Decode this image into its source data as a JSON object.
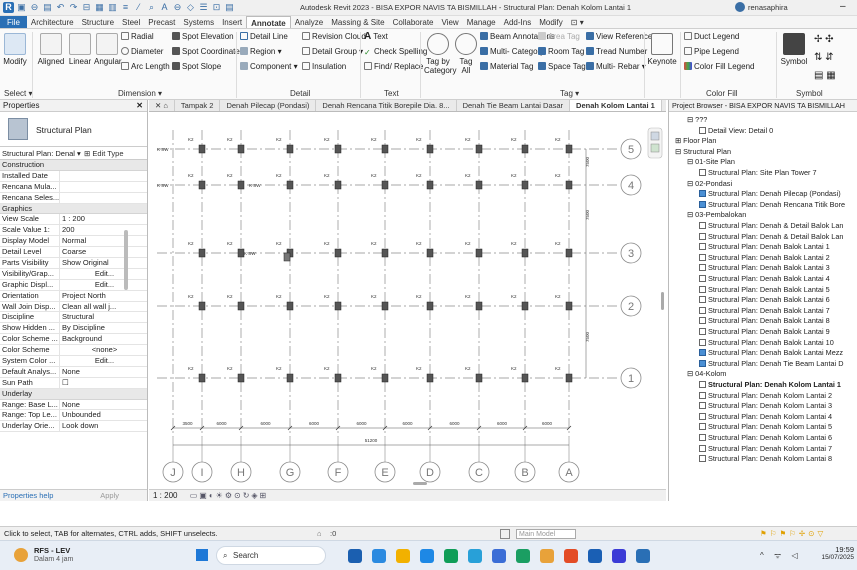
{
  "title_bar": {
    "title": "Autodesk Revit 2023 - BISA EXPOR NAVIS TA BISMILLAH - Structural Plan: Denah Kolom Lantai 1",
    "user": "renasaphira",
    "quick_access": [
      "R",
      "▣",
      "⊖",
      "▤",
      "↶",
      "↷",
      "⊟",
      "▦",
      "▥",
      "≡",
      "⁄",
      "⌕",
      "A",
      "⊖",
      "◇",
      "☰",
      "⊡",
      "▤"
    ]
  },
  "ribbon_tabs": [
    "File",
    "Architecture",
    "Structure",
    "Steel",
    "Precast",
    "Systems",
    "Insert",
    "Annotate",
    "Analyze",
    "Massing & Site",
    "Collaborate",
    "View",
    "Manage",
    "Add-Ins",
    "Modify"
  ],
  "active_tab": "Annotate",
  "ribbon": {
    "select": {
      "modify": "Modify",
      "label": "Select ▾"
    },
    "dimension": {
      "aligned": "Aligned",
      "linear": "Linear",
      "angular": "Angular",
      "radial": "Radial",
      "diameter": "Diameter",
      "arc_length": "Arc Length",
      "spot_elevation": "Spot Elevation",
      "spot_coordinate": "Spot Coordinate",
      "spot_slope": "Spot Slope",
      "label": "Dimension ▾"
    },
    "detail": {
      "detail_line": "Detail Line",
      "region": "Region ▾",
      "component": "Component ▾",
      "revision_cloud": "Revision Cloud",
      "detail_group": "Detail Group ▾",
      "insulation": "Insulation",
      "label": "Detail"
    },
    "text": {
      "text": "Text",
      "check_spelling": "Check Spelling",
      "find_replace": "Find/ Replace",
      "label": "Text"
    },
    "tag": {
      "tag_by_category": "Tag by Category",
      "tag_all": "Tag All",
      "beam_annotations": "Beam Annotations",
      "multi_category": "Multi- Category",
      "material_tag": "Material Tag",
      "area_tag": "Area Tag",
      "room_tag": "Room Tag",
      "space_tag": "Space Tag",
      "view_reference": "View Reference",
      "tread_number": "Tread Number",
      "multi_rebar": "Multi- Rebar ▾",
      "keynote": "Keynote",
      "label": "Tag ▾"
    },
    "color_fill": {
      "duct_legend": "Duct Legend",
      "pipe_legend": "Pipe Legend",
      "color_fill_legend": "Color Fill Legend",
      "label": "Color Fill"
    },
    "symbol": {
      "symbol": "Symbol",
      "label": "Symbol"
    }
  },
  "properties": {
    "header": "Properties",
    "type_name": "Structural Plan",
    "selector": "Structural Plan: Denal ▾",
    "edit_type": "Edit Type",
    "rows": [
      {
        "section": "Construction"
      },
      {
        "k": "Installed Date",
        "v": ""
      },
      {
        "k": "Rencana Mula...",
        "v": ""
      },
      {
        "k": "Rencana Seles...",
        "v": ""
      },
      {
        "section": "Graphics"
      },
      {
        "k": "View Scale",
        "v": "1 : 200"
      },
      {
        "k": "Scale Value  1:",
        "v": "200"
      },
      {
        "k": "Display Model",
        "v": "Normal"
      },
      {
        "k": "Detail Level",
        "v": "Coarse"
      },
      {
        "k": "Parts Visibility",
        "v": "Show Original"
      },
      {
        "k": "Visibility/Grap...",
        "v": "Edit..."
      },
      {
        "k": "Graphic Displ...",
        "v": "Edit..."
      },
      {
        "k": "Orientation",
        "v": "Project North"
      },
      {
        "k": "Wall Join Disp...",
        "v": "Clean all wall j..."
      },
      {
        "k": "Discipline",
        "v": "Structural"
      },
      {
        "k": "Show Hidden ...",
        "v": "By Discipline"
      },
      {
        "k": "Color Scheme ...",
        "v": "Background"
      },
      {
        "k": "Color Scheme",
        "v": "<none>"
      },
      {
        "k": "System Color ...",
        "v": "Edit..."
      },
      {
        "k": "Default Analys...",
        "v": "None"
      },
      {
        "k": "Sun Path",
        "v": "☐"
      },
      {
        "section": "Underlay"
      },
      {
        "k": "Range: Base L...",
        "v": "None"
      },
      {
        "k": "Range: Top Le...",
        "v": "Unbounded"
      },
      {
        "k": "Underlay Orie...",
        "v": "Look down"
      }
    ],
    "help": "Properties help",
    "apply": "Apply"
  },
  "view_tabs": [
    "Tampak 2",
    "Denah Pilecap (Pondasi)",
    "Denah Rencana Titik Borepile Dia. 8...",
    "Denah Tie Beam Lantai Dasar",
    "Denah Kolom Lantai 1"
  ],
  "active_view": "Denah Kolom Lantai 1",
  "drawing": {
    "grid_h": [
      "5",
      "4",
      "3",
      "2",
      "1"
    ],
    "grid_v": [
      "J",
      "I",
      "H",
      "G",
      "F",
      "E",
      "D",
      "C",
      "B",
      "A"
    ],
    "col_tag": "K2",
    "wall_tag": "K SW",
    "dims": [
      "3500",
      "6000",
      "6000",
      "6000",
      "6000",
      "6000",
      "6000",
      "6000",
      "6000",
      "3500"
    ],
    "overall": "51200",
    "vdims": [
      "7500",
      "7500",
      "7500"
    ]
  },
  "view_bar": {
    "scale": "1 : 200"
  },
  "project_browser": {
    "header": "Project Browser - BISA EXPOR NAVIS TA BISMILLAH",
    "items": [
      {
        "t": "???",
        "lvl": 1,
        "ex": "⊟"
      },
      {
        "t": "Detail View: Detail 0",
        "lvl": 2
      },
      {
        "t": "Floor Plan",
        "lvl": 0,
        "ex": "⊞"
      },
      {
        "t": "Structural Plan",
        "lvl": 0,
        "ex": "⊟"
      },
      {
        "t": "01-Site Plan",
        "lvl": 1,
        "ex": "⊟"
      },
      {
        "t": "Structural Plan: Site Plan Tower 7",
        "lvl": 2
      },
      {
        "t": "02-Pondasi",
        "lvl": 1,
        "ex": "⊟"
      },
      {
        "t": "Structural Plan: Denah Pilecap (Pondasi)",
        "lvl": 2,
        "hl": true
      },
      {
        "t": "Structural Plan: Denah Rencana Titik Bore",
        "lvl": 2,
        "hl": true
      },
      {
        "t": "03-Pembalokan",
        "lvl": 1,
        "ex": "⊟"
      },
      {
        "t": "Structural Plan: Denah & Detail Balok Lan",
        "lvl": 2
      },
      {
        "t": "Structural Plan: Denah & Detail Balok Lan",
        "lvl": 2
      },
      {
        "t": "Structural Plan: Denah Balok Lantai 1",
        "lvl": 2
      },
      {
        "t": "Structural Plan: Denah Balok Lantai 2",
        "lvl": 2
      },
      {
        "t": "Structural Plan: Denah Balok Lantai 3",
        "lvl": 2
      },
      {
        "t": "Structural Plan: Denah Balok Lantai 4",
        "lvl": 2
      },
      {
        "t": "Structural Plan: Denah Balok Lantai 5",
        "lvl": 2
      },
      {
        "t": "Structural Plan: Denah Balok Lantai 6",
        "lvl": 2
      },
      {
        "t": "Structural Plan: Denah Balok Lantai 7",
        "lvl": 2
      },
      {
        "t": "Structural Plan: Denah Balok Lantai 8",
        "lvl": 2
      },
      {
        "t": "Structural Plan: Denah Balok Lantai 9",
        "lvl": 2
      },
      {
        "t": "Structural Plan: Denah Balok Lantai 10",
        "lvl": 2
      },
      {
        "t": "Structural Plan: Denah Balok Lantai Mezz",
        "lvl": 2,
        "hl": true
      },
      {
        "t": "Structural Plan: Denah Tie Beam Lantai D",
        "lvl": 2,
        "hl": true
      },
      {
        "t": "04-Kolom",
        "lvl": 1,
        "ex": "⊟"
      },
      {
        "t": "Structural Plan: Denah Kolom Lantai 1",
        "lvl": 2,
        "bold": true
      },
      {
        "t": "Structural Plan: Denah Kolom Lantai 2",
        "lvl": 2
      },
      {
        "t": "Structural Plan: Denah Kolom Lantai 3",
        "lvl": 2
      },
      {
        "t": "Structural Plan: Denah Kolom Lantai 4",
        "lvl": 2
      },
      {
        "t": "Structural Plan: Denah Kolom Lantai 5",
        "lvl": 2
      },
      {
        "t": "Structural Plan: Denah Kolom Lantai 6",
        "lvl": 2
      },
      {
        "t": "Structural Plan: Denah Kolom Lantai 7",
        "lvl": 2
      },
      {
        "t": "Structural Plan: Denah Kolom Lantai 8",
        "lvl": 2
      }
    ]
  },
  "status_bar": {
    "text": "Click to select, TAB for alternates, CTRL adds, SHIFT unselects.",
    "model": "Main Model",
    "zero": ":0"
  },
  "taskbar": {
    "weather_title": "RFS - LEV",
    "weather_sub": "Dalam 4 jam",
    "search": "Search",
    "time": "19:59",
    "date": "15/07/2025"
  },
  "colors": {
    "file_tab": "#2a6fb5",
    "grid_line": "#8a8a8a",
    "highlight": "#4a8fd4"
  }
}
